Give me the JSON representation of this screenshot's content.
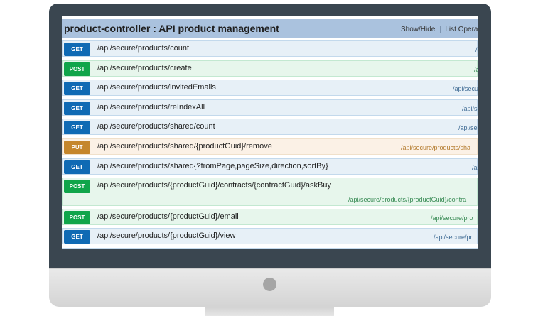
{
  "controller": {
    "title": "product-controller : API product management",
    "links": [
      "Show/Hide",
      "List Operat"
    ]
  },
  "operations": [
    {
      "method": "GET",
      "path": "/api/secure/products/count",
      "meta": "/a"
    },
    {
      "method": "POST",
      "path": "/api/secure/products/create",
      "meta": "/a"
    },
    {
      "method": "GET",
      "path": "/api/secure/products/invitedEmails",
      "meta": "/api/secu"
    },
    {
      "method": "GET",
      "path": "/api/secure/products/reIndexAll",
      "meta": "/api/s"
    },
    {
      "method": "GET",
      "path": "/api/secure/products/shared/count",
      "meta": "/api/se"
    },
    {
      "method": "PUT",
      "path": "/api/secure/products/shared/{productGuid}/remove",
      "meta": "/api/secure/products/sha"
    },
    {
      "method": "GET",
      "path": "/api/secure/products/shared{?fromPage,pageSize,direction,sortBy}",
      "meta": "/a"
    },
    {
      "method": "POST",
      "path": "/api/secure/products/{productGuid}/contracts/{contractGuid}/askBuy",
      "meta": "/api/secure/products/{productGuid}/contra"
    },
    {
      "method": "POST",
      "path": "/api/secure/products/{productGuid}/email",
      "meta": "/api/secure/pro"
    },
    {
      "method": "GET",
      "path": "/api/secure/products/{productGuid}/view",
      "meta": "/api/secure/pr"
    }
  ],
  "colors": {
    "get": "#0f6ab4",
    "post": "#10a54a",
    "put": "#c5862b",
    "header": "#aac2de",
    "bezel": "#3a4650"
  }
}
